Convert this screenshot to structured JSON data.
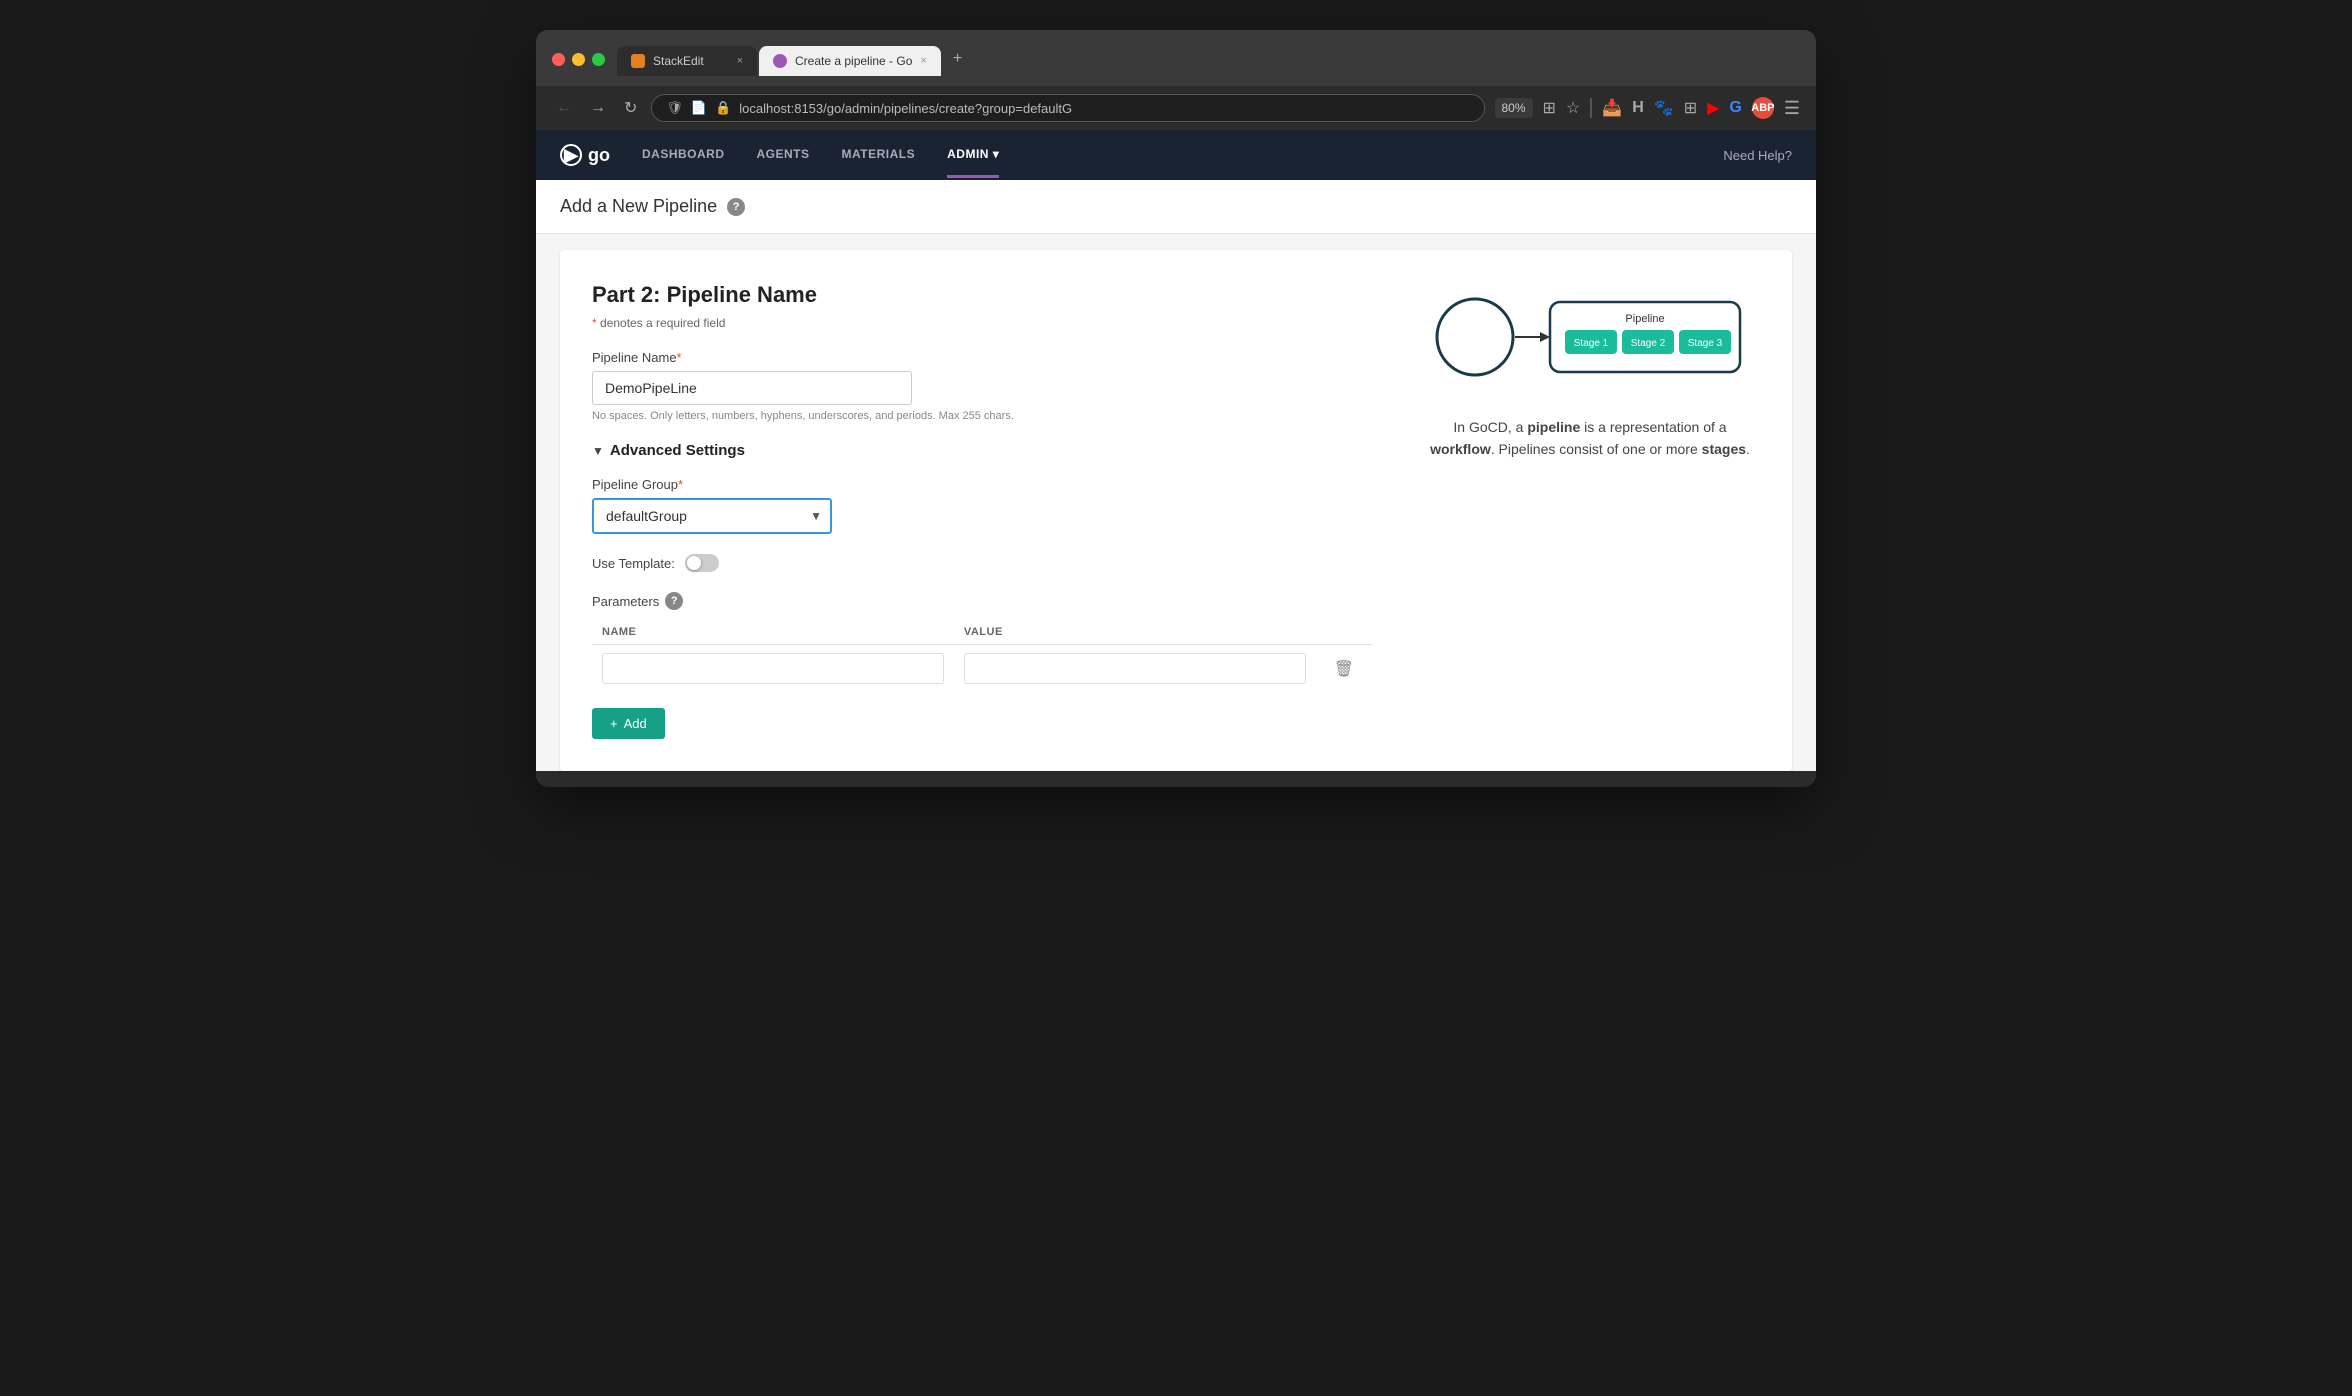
{
  "browser": {
    "tabs": [
      {
        "id": "stackedit",
        "label": "StackEdit",
        "active": false,
        "icon_color": "#e67e22"
      },
      {
        "id": "gocd",
        "label": "Create a pipeline - Go",
        "active": true,
        "icon_color": "#9b59b6"
      }
    ],
    "new_tab_label": "+",
    "address": "localhost:8153/go/admin/pipelines/create?group=defaultG",
    "zoom": "80%"
  },
  "nav": {
    "logo": "go",
    "links": [
      {
        "id": "dashboard",
        "label": "DASHBOARD",
        "active": false
      },
      {
        "id": "agents",
        "label": "AGENTS",
        "active": false
      },
      {
        "id": "materials",
        "label": "MATERIALS",
        "active": false
      },
      {
        "id": "admin",
        "label": "ADMIN ▾",
        "active": true
      }
    ],
    "help": "Need Help?"
  },
  "page": {
    "title": "Add a New Pipeline",
    "help_icon": "?"
  },
  "form": {
    "part_label": "Part 2: Pipeline Name",
    "required_note": "* denotes a required field",
    "pipeline_name_label": "Pipeline Name",
    "pipeline_name_required": "*",
    "pipeline_name_value": "DemoPipeLine",
    "pipeline_name_hint": "No spaces. Only letters, numbers, hyphens, underscores, and periods. Max 255 chars.",
    "advanced_settings_label": "Advanced Settings",
    "pipeline_group_label": "Pipeline Group",
    "pipeline_group_required": "*",
    "pipeline_group_value": "defaultGroup",
    "pipeline_group_options": [
      "defaultGroup"
    ],
    "use_template_label": "Use Template:",
    "parameters_label": "Parameters",
    "parameters_col_name": "NAME",
    "parameters_col_value": "VALUE",
    "add_button_label": "+ Add"
  },
  "info": {
    "description_html": "In GoCD, a <strong>pipeline</strong> is a representation of a <strong>workflow</strong>. Pipelines consist of one or more <strong>stages</strong>.",
    "diagram": {
      "stages": [
        "Stage 1",
        "Stage 2",
        "Stage 3"
      ],
      "pipeline_label": "Pipeline"
    }
  },
  "icons": {
    "back": "←",
    "forward": "→",
    "refresh": "↻",
    "close": "×",
    "shield": "🛡",
    "bookmark": "🔖",
    "star": "☆",
    "trash": "🗑",
    "delete": "🗑"
  }
}
